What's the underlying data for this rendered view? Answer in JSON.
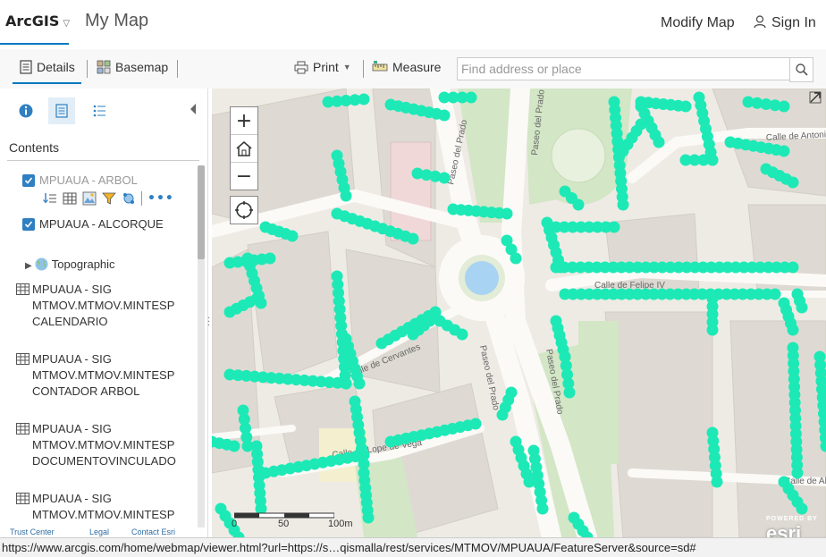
{
  "header": {
    "brand": "ArcGIS",
    "map_title": "My Map",
    "modify_label": "Modify Map",
    "signin_label": "Sign In"
  },
  "toolbar": {
    "details_label": "Details",
    "basemap_label": "Basemap",
    "print_label": "Print",
    "measure_label": "Measure",
    "search_placeholder": "Find address or place"
  },
  "sidebar": {
    "contents_title": "Contents",
    "layers": [
      {
        "label": "MPUAUA - ARBOL",
        "checked": true
      },
      {
        "label": "MPUAUA - ALCORQUE",
        "checked": true
      }
    ],
    "basemap_item": "Topographic",
    "tables": [
      {
        "line1": "MPUAUA - SIG",
        "line2": "MTMOV.MTMOV.MINTESP",
        "line3": "CALENDARIO"
      },
      {
        "line1": "MPUAUA - SIG",
        "line2": "MTMOV.MTMOV.MINTESP",
        "line3": "CONTADOR ARBOL"
      },
      {
        "line1": "MPUAUA - SIG",
        "line2": "MTMOV.MTMOV.MINTESP",
        "line3": "DOCUMENTOVINCULADO"
      },
      {
        "line1": "MPUAUA - SIG",
        "line2": "MTMOV.MTMOV.MINTESP",
        "line3": ""
      }
    ],
    "footer": {
      "trust": "Trust Center",
      "legal": "Legal",
      "contact": "Contact Esri"
    }
  },
  "map": {
    "street_labels": [
      "Paseo del Prado",
      "Paseo del Prado",
      "Paseo del Prado",
      "Paseo del Prado",
      "Calle de Felipe IV",
      "Calle de Cervantes",
      "Calle de Lope de Vega",
      "Calle de Antonio",
      "Calle de Albe"
    ],
    "scale_labels": [
      "0",
      "50",
      "100m"
    ],
    "attribution_top": "POWERED BY",
    "attribution": "esri",
    "feature_color": "#1de9b6"
  },
  "status_url": "https://www.arcgis.com/home/webmap/viewer.html?url=https://s…qismalla/rest/services/MTMOV/MPUAUA/FeatureServer&source=sd#"
}
